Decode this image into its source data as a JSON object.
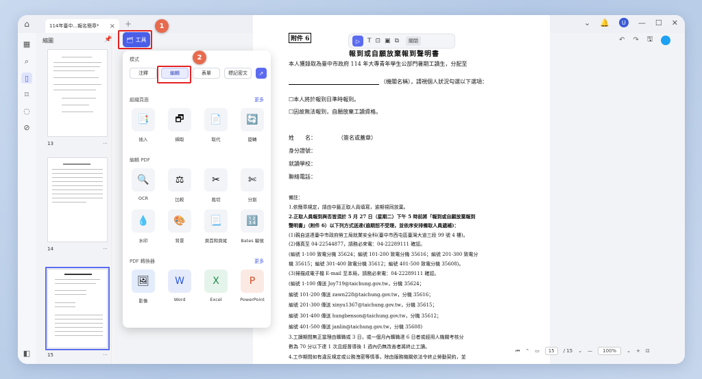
{
  "titlebar": {
    "tab_title": "114年臺中...報名簡章*",
    "tab_close": "×",
    "new_tab": "+"
  },
  "thumbnails": {
    "header": "縮圖",
    "pages": [
      {
        "number": "13",
        "menu": "···"
      },
      {
        "number": "14",
        "menu": "···"
      },
      {
        "number": "15",
        "menu": "···"
      }
    ]
  },
  "tools_button": {
    "label": "工具"
  },
  "steps": [
    "1",
    "2"
  ],
  "popup": {
    "mode_section": "模式",
    "modes": [
      "注釋",
      "編輯",
      "表單",
      "標記密文"
    ],
    "selected_mode": "編輯",
    "organize_section": "組織頁面",
    "organize_more": "更多",
    "organize_tools": [
      "插入",
      "擷取",
      "取代",
      "旋轉"
    ],
    "edit_section": "編輯 PDF",
    "edit_tools": [
      "OCR",
      "比較",
      "裁切",
      "分割",
      "水印",
      "背景",
      "頁首和頁尾",
      "Bates 編號"
    ],
    "convert_section": "PDF 轉換器",
    "convert_more": "更多",
    "convert_tools": [
      "影像",
      "Word",
      "Excel",
      "PowerPoint"
    ]
  },
  "floating_toolbar": {
    "close_label": "關閉"
  },
  "document": {
    "attachment": "附件 6",
    "title": "報到或自願放棄報到聲明書",
    "line1": "本人獲錄取為臺中市政府 114 年大專青年學生公部門暑期工讀生，分配至",
    "line2": "（機關名稱），請視個人狀況勾選以下選項：",
    "opt1": "☐本人將於報到日準時報到。",
    "opt2": "☐因故無法報到，自願放棄工讀資格。",
    "name": "姓　　名：　　　　　（簽名或蓋章）",
    "id": "身分證號：",
    "school": "就讀學校：",
    "phone": "聯絡電話：",
    "notes_title": "備註：",
    "notes": [
      "1.依簡章規定，請由中籤正取人員填寫，逾期視同放棄。",
      "2.正取人員報到與否皆須於 5 月 27 日（星期二）下午 5 時前將「報到或自願放棄報到",
      "  聲明書」（附件 6）以下列方式送達(逾期恕不受理，並依序安排備取人員遞補)：",
      "(1)親自送達臺中市政府勞工局就業安全科(臺中市西屯區臺灣大道三段 99 號 4 樓)。",
      "(2)傳真至 04-22544877，請務必來電：04-22289111 確認。",
      "  (編號 1-100 致電分機 35624；編號 101-200 致電分機 35616；編號 201-300 致電分",
      "  機 35615；編號 301-400 致電分機 35612；編號 401-500 致電分機 35608)。",
      "(3)掃描成電子檔 E-mail 至本局，請務必來電：04-22289111 確認。",
      "  (編號 1-100 傳送 Joy719@taichung.gov.tw，分機 35624；",
      "  編號 101-200 傳送 zawn228@taichung.gov.tw，分機 35616；",
      "  編號 201-300 傳送 xinyu1367@taichung.gov.tw，分機 35615；",
      "  編號 301-400 傳送 hungbenson@taichung.gov.tw，分機 35612；",
      "  編號 401-500 傳送 janlin@taichung.gov.tw，分機 35608)",
      "3.工讀期間無正當理由曠職或 3 日，或一個月內曠職達 6 日者或經用人機關考核分",
      "  數為 70 分以下達 1 次且經督導後 1 週內仍無改善者將終止工讀。",
      "4.工作期間如有違反規定或公務洩密等情事，除由服務機關依法令終止勞動契約，並"
    ]
  },
  "bottom_bar": {
    "page_current": "15",
    "page_total": "/ 15",
    "zoom": "100%"
  },
  "colors": {
    "accent": "#4a5ee8",
    "highlight": "#e32121",
    "step_badge": "#e86a4e"
  }
}
